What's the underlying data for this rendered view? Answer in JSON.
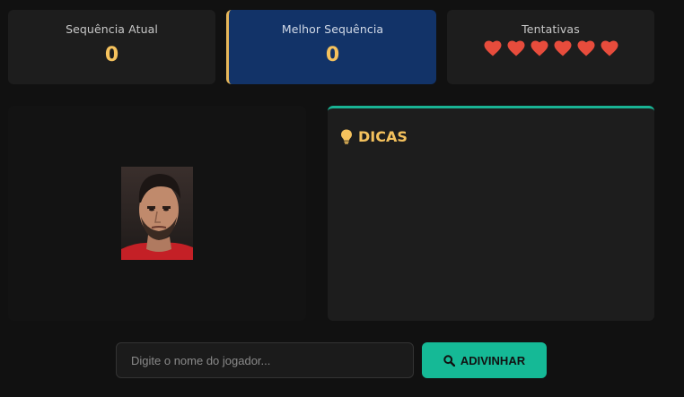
{
  "stats": {
    "current_streak": {
      "label": "Sequência Atual",
      "value": "0"
    },
    "best_streak": {
      "label": "Melhor Sequência",
      "value": "0"
    },
    "attempts": {
      "label": "Tentativas",
      "hearts": 6,
      "heart_icon": "heart-icon",
      "heart_color": "#e74c3c"
    }
  },
  "player": {
    "photo_icon": "player-photo"
  },
  "hints": {
    "title": "DICAS",
    "icon": "lightbulb-icon"
  },
  "guess": {
    "placeholder": "Digite o nome do jogador...",
    "value": "",
    "button_label": "ADIVINHAR",
    "button_icon": "search-icon"
  },
  "colors": {
    "accent_teal": "#15b996",
    "accent_gold": "#f5c25d",
    "best_card_bg": "#123368",
    "background": "#111111"
  }
}
